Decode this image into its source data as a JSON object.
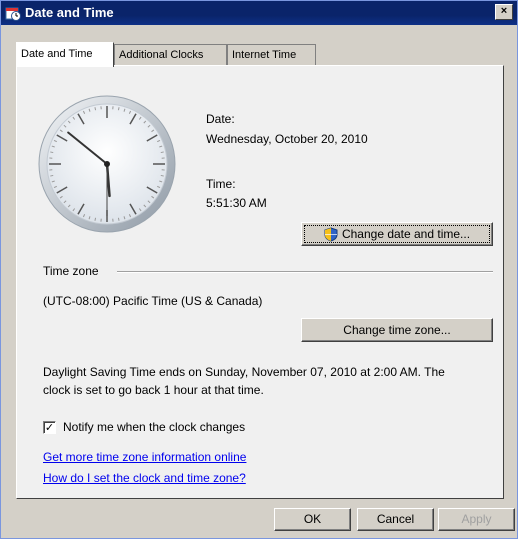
{
  "window": {
    "title": "Date and Time",
    "close_glyph": "×"
  },
  "tabs": [
    {
      "label": "Date and Time",
      "active": true
    },
    {
      "label": "Additional Clocks",
      "active": false
    },
    {
      "label": "Internet Time",
      "active": false
    }
  ],
  "clock": {
    "hour": 5,
    "minute": 51,
    "second": 30
  },
  "date": {
    "label": "Date:",
    "value": "Wednesday, October 20, 2010"
  },
  "time": {
    "label": "Time:",
    "value": "5:51:30 AM"
  },
  "buttons": {
    "change_date_time": "Change date and time...",
    "change_time_zone": "Change time zone...",
    "ok": "OK",
    "cancel": "Cancel",
    "apply": "Apply"
  },
  "timezone": {
    "section_label": "Time zone",
    "value": "(UTC-08:00) Pacific Time (US & Canada)"
  },
  "dst_notice": {
    "line1": "Daylight Saving Time ends on Sunday, November 07, 2010 at 2:00 AM. The",
    "line2": "clock is set to go back 1 hour at that time."
  },
  "notify": {
    "label": "Notify me when the clock changes",
    "checked": true,
    "check_glyph": "✓"
  },
  "links": {
    "timezone_info": "Get more time zone information online",
    "how_to": "How do I set the clock and time zone?"
  },
  "colors": {
    "titlebar": "#0a246a",
    "link": "#0000ee",
    "panel": "#f0f0f0",
    "face": "#d4d0c8"
  }
}
